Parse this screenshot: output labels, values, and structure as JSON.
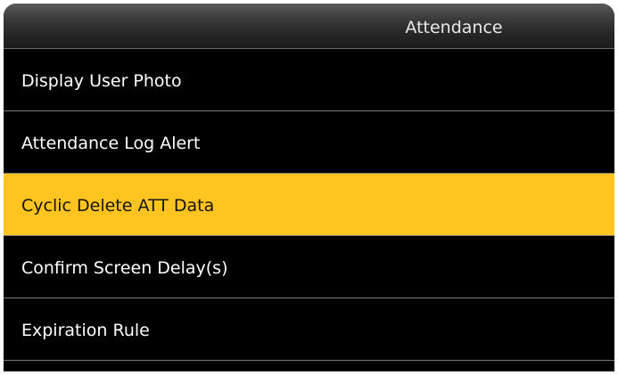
{
  "header": {
    "title": "Attendance"
  },
  "menu": {
    "items": [
      {
        "label": "Display User Photo"
      },
      {
        "label": "Attendance Log Alert"
      },
      {
        "label": "Cyclic Delete ATT Data"
      },
      {
        "label": "Confirm Screen Delay(s)"
      },
      {
        "label": "Expiration Rule"
      }
    ],
    "selected_index": 2
  },
  "colors": {
    "background": "#000000",
    "highlight": "#ffc41f",
    "divider": "#7a7a7a",
    "text": "#ffffff"
  }
}
